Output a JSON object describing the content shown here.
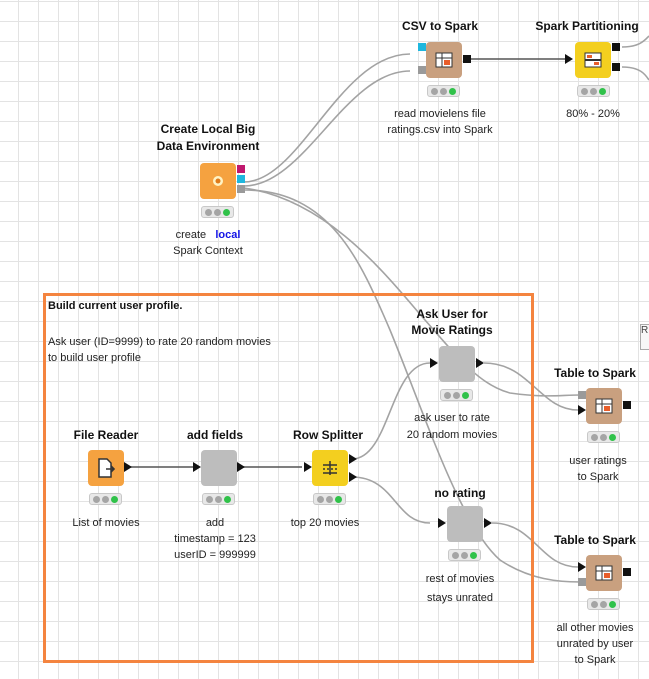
{
  "nodes": {
    "create_env": {
      "title_line1": "Create Local Big",
      "title_line2": "Data Environment",
      "caption_prefix": "create",
      "caption_highlight": "local",
      "caption_line2": "Spark Context"
    },
    "csv_to_spark": {
      "title": "CSV to Spark",
      "caption_line1": "read movielens file",
      "caption_line2": "ratings.csv into Spark"
    },
    "spark_partitioning": {
      "title": "Spark Partitioning",
      "caption": "80% - 20%"
    },
    "file_reader": {
      "title": "File Reader",
      "caption": "List of movies"
    },
    "add_fields": {
      "title": "add fields",
      "caption_line1": "add",
      "caption_line2": "timestamp = 123",
      "caption_line3": "userID = 999999"
    },
    "row_splitter": {
      "title": "Row Splitter",
      "caption": "top 20 movies"
    },
    "ask_user": {
      "title_line1": "Ask User for",
      "title_line2": "Movie Ratings",
      "caption_line1": "ask user to rate",
      "caption_line2": "20 random movies"
    },
    "no_rating": {
      "title": "no rating",
      "caption_line1": "rest of movies",
      "caption_line2": "stays unrated"
    },
    "table_to_spark_1": {
      "title": "Table to Spark",
      "caption_line1": "user ratings",
      "caption_line2": "to Spark"
    },
    "table_to_spark_2": {
      "title": "Table to Spark",
      "caption_line1": "all other movies",
      "caption_line2": "unrated by user",
      "caption_line3": "to Spark"
    }
  },
  "annotation": {
    "title": "Build current user profile.",
    "line1": "Ask user (ID=9999)  to rate 20 random movies",
    "line2": "to build user profile"
  },
  "edge_label": "R",
  "colors": {
    "annotation_border": "#f4843f",
    "node_orange": "#f5a240",
    "node_tan": "#c9a07f",
    "node_yellow": "#f3cf1f",
    "node_gray": "#bdbdbd",
    "status_green": "#30c24a",
    "local_link": "#1414e6"
  },
  "icons": {
    "create_env": "spark-star-icon",
    "csv_to_spark": "spark-table-icon",
    "spark_partitioning": "partition-icon",
    "file_reader": "file-reader-icon",
    "row_splitter": "row-splitter-icon",
    "table_to_spark": "spark-table-icon"
  }
}
